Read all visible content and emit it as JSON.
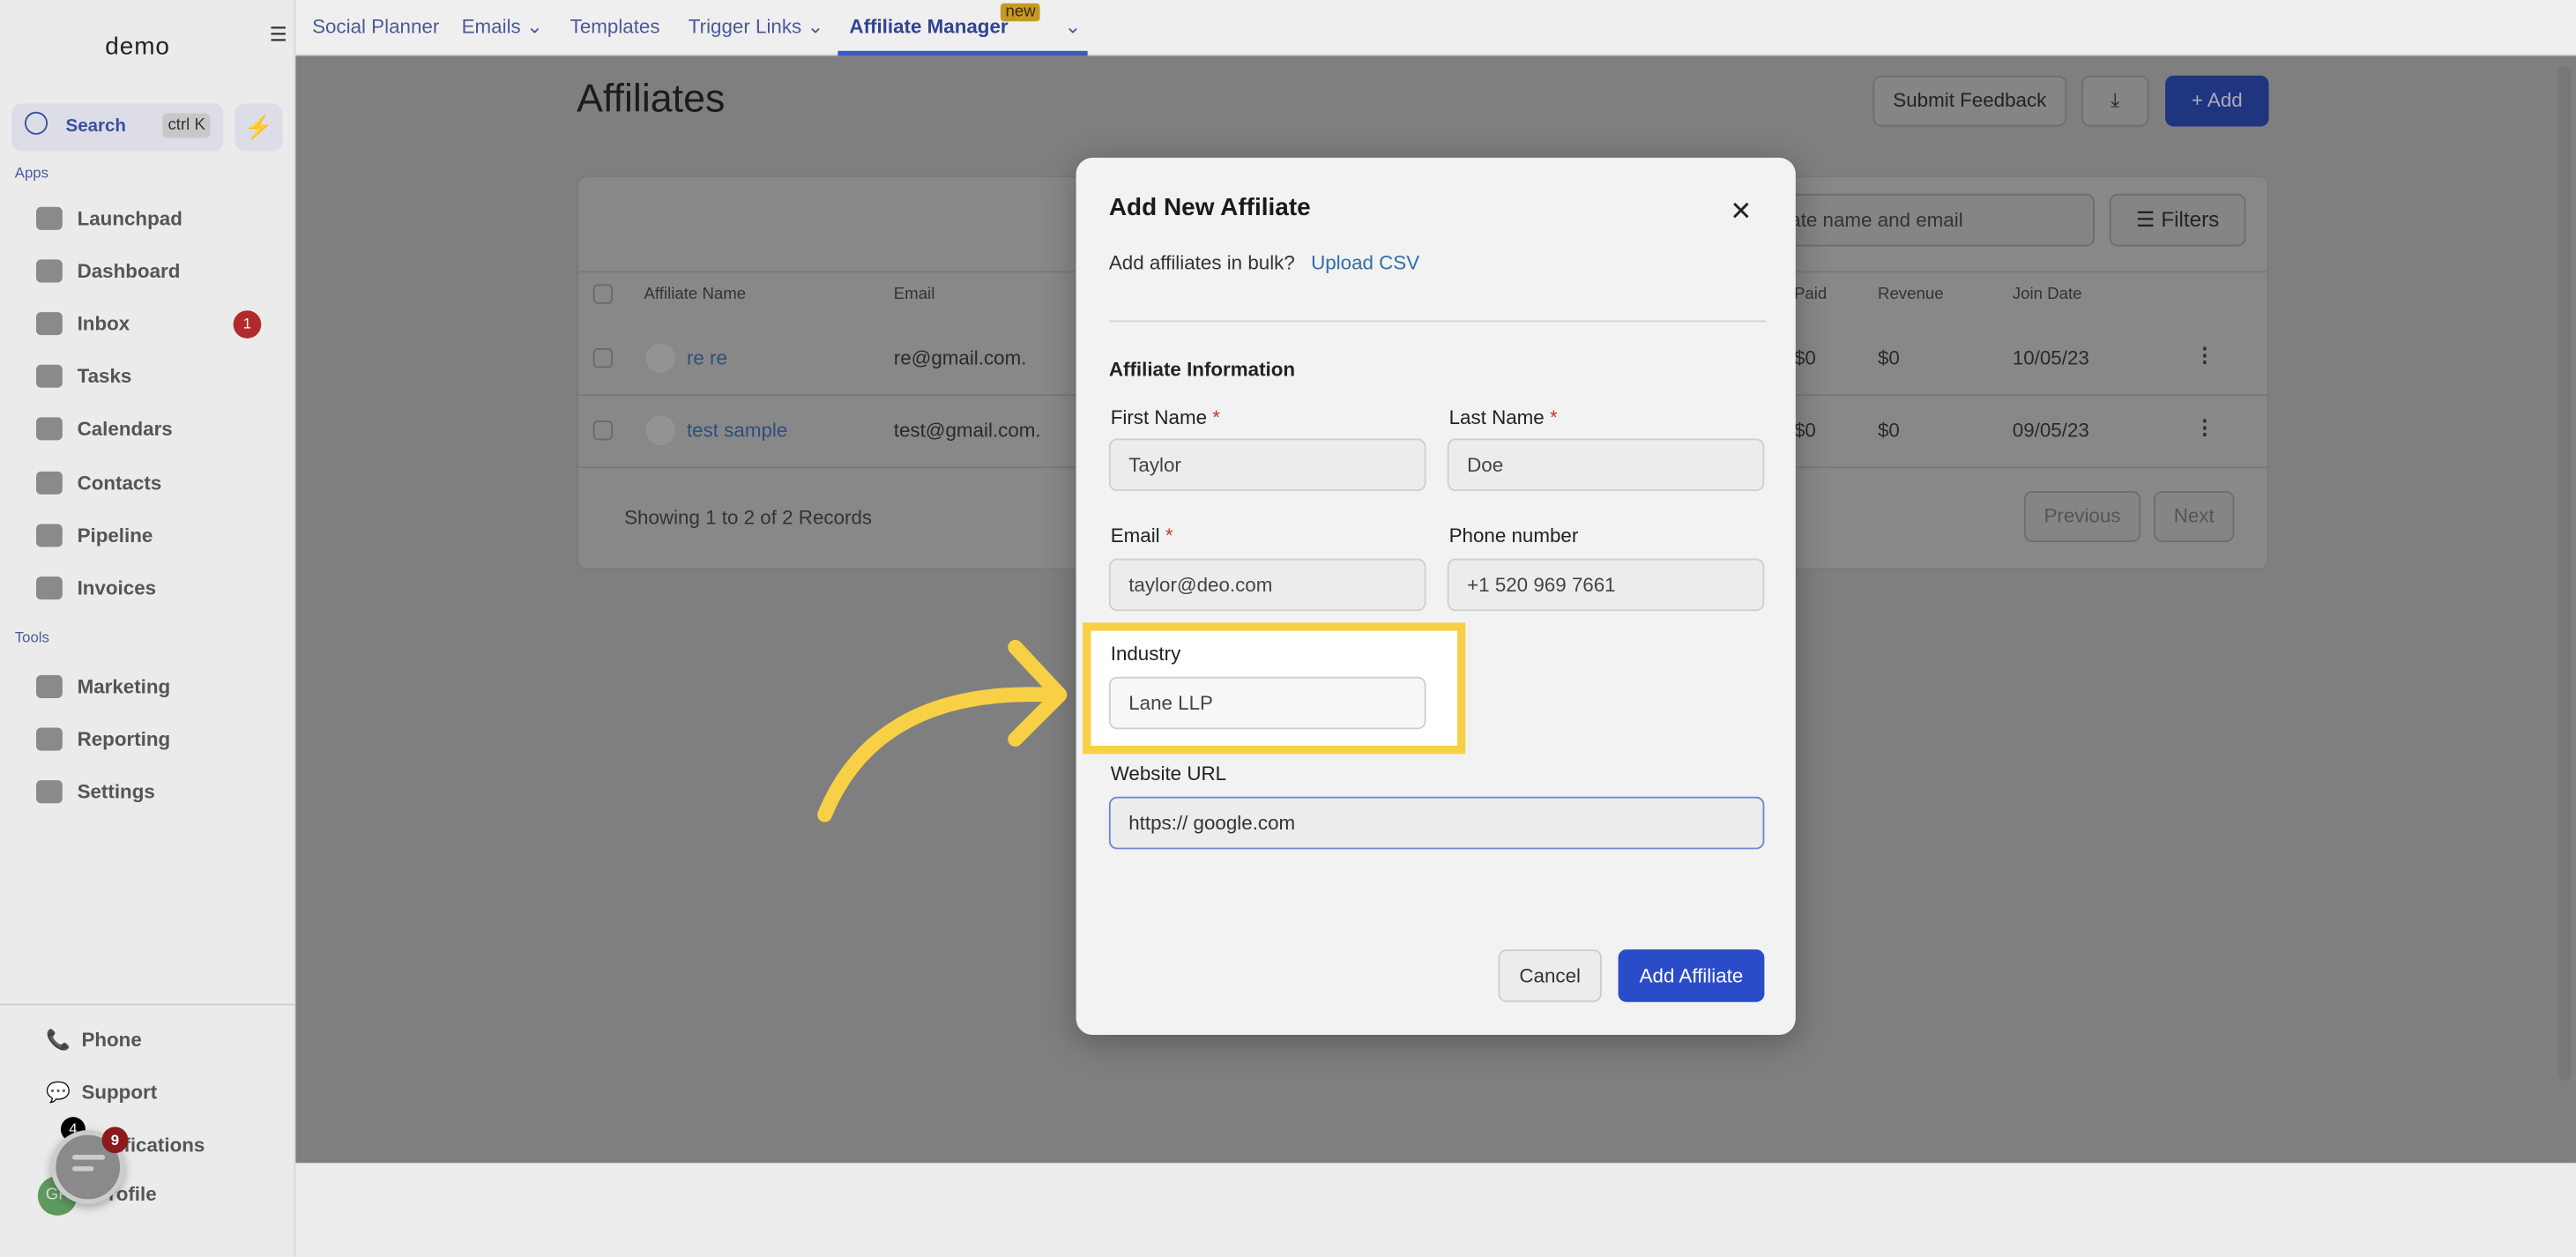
{
  "sidebar": {
    "logo": "demo",
    "search_label": "Search",
    "search_shortcut": "ctrl K",
    "apps_label": "Apps",
    "tools_label": "Tools",
    "apps": [
      {
        "label": "Launchpad"
      },
      {
        "label": "Dashboard"
      },
      {
        "label": "Inbox",
        "badge": "1"
      },
      {
        "label": "Tasks"
      },
      {
        "label": "Calendars"
      },
      {
        "label": "Contacts"
      },
      {
        "label": "Pipeline"
      },
      {
        "label": "Invoices"
      }
    ],
    "tools": [
      {
        "label": "Marketing"
      },
      {
        "label": "Reporting"
      },
      {
        "label": "Settings"
      }
    ],
    "bottom": [
      {
        "label": "Phone"
      },
      {
        "label": "Support"
      },
      {
        "label": "Notifications"
      },
      {
        "label": "Profile"
      }
    ],
    "avatar_initials": "GP",
    "notif_badge": "4",
    "chat_badge": "9"
  },
  "topnav": {
    "tabs": [
      {
        "label": "Social Planner"
      },
      {
        "label": "Emails"
      },
      {
        "label": "Templates"
      },
      {
        "label": "Trigger Links"
      },
      {
        "label": "Affiliate Manager"
      }
    ],
    "new_badge": "new"
  },
  "page": {
    "title": "Affiliates",
    "submit_feedback": "Submit Feedback",
    "add_label": "Add",
    "search_placeholder": "Search by affiliate name and email",
    "filters": "Filters",
    "columns": [
      "Affiliate Name",
      "Email",
      "Paid",
      "Revenue",
      "Join Date"
    ],
    "rows": [
      {
        "name": "re re",
        "email": "re@gmail.com.",
        "paid": "$0",
        "revenue": "$0",
        "join": "10/05/23"
      },
      {
        "name": "test sample",
        "email": "test@gmail.com.",
        "paid": "$0",
        "revenue": "$0",
        "join": "09/05/23"
      }
    ],
    "records": "Showing 1 to 2 of 2 Records",
    "previous": "Previous",
    "next": "Next"
  },
  "modal": {
    "title": "Add New Affiliate",
    "bulk_text": "Add affiliates in bulk?",
    "upload_csv": "Upload CSV",
    "section": "Affiliate Information",
    "first_name_label": "First Name",
    "first_name": "Taylor",
    "last_name_label": "Last Name",
    "last_name": "Doe",
    "email_label": "Email",
    "email": "taylor@deo.com",
    "phone_label": "Phone number",
    "phone": "+1 520 969 7661",
    "industry_label": "Industry",
    "industry": "Lane LLP",
    "website_label": "Website URL",
    "website": "https:// google.com",
    "required_mark": "*",
    "cancel": "Cancel",
    "submit": "Add Affiliate"
  },
  "colors": {
    "accent": "#2b4cc9",
    "highlight": "#f7d046"
  }
}
